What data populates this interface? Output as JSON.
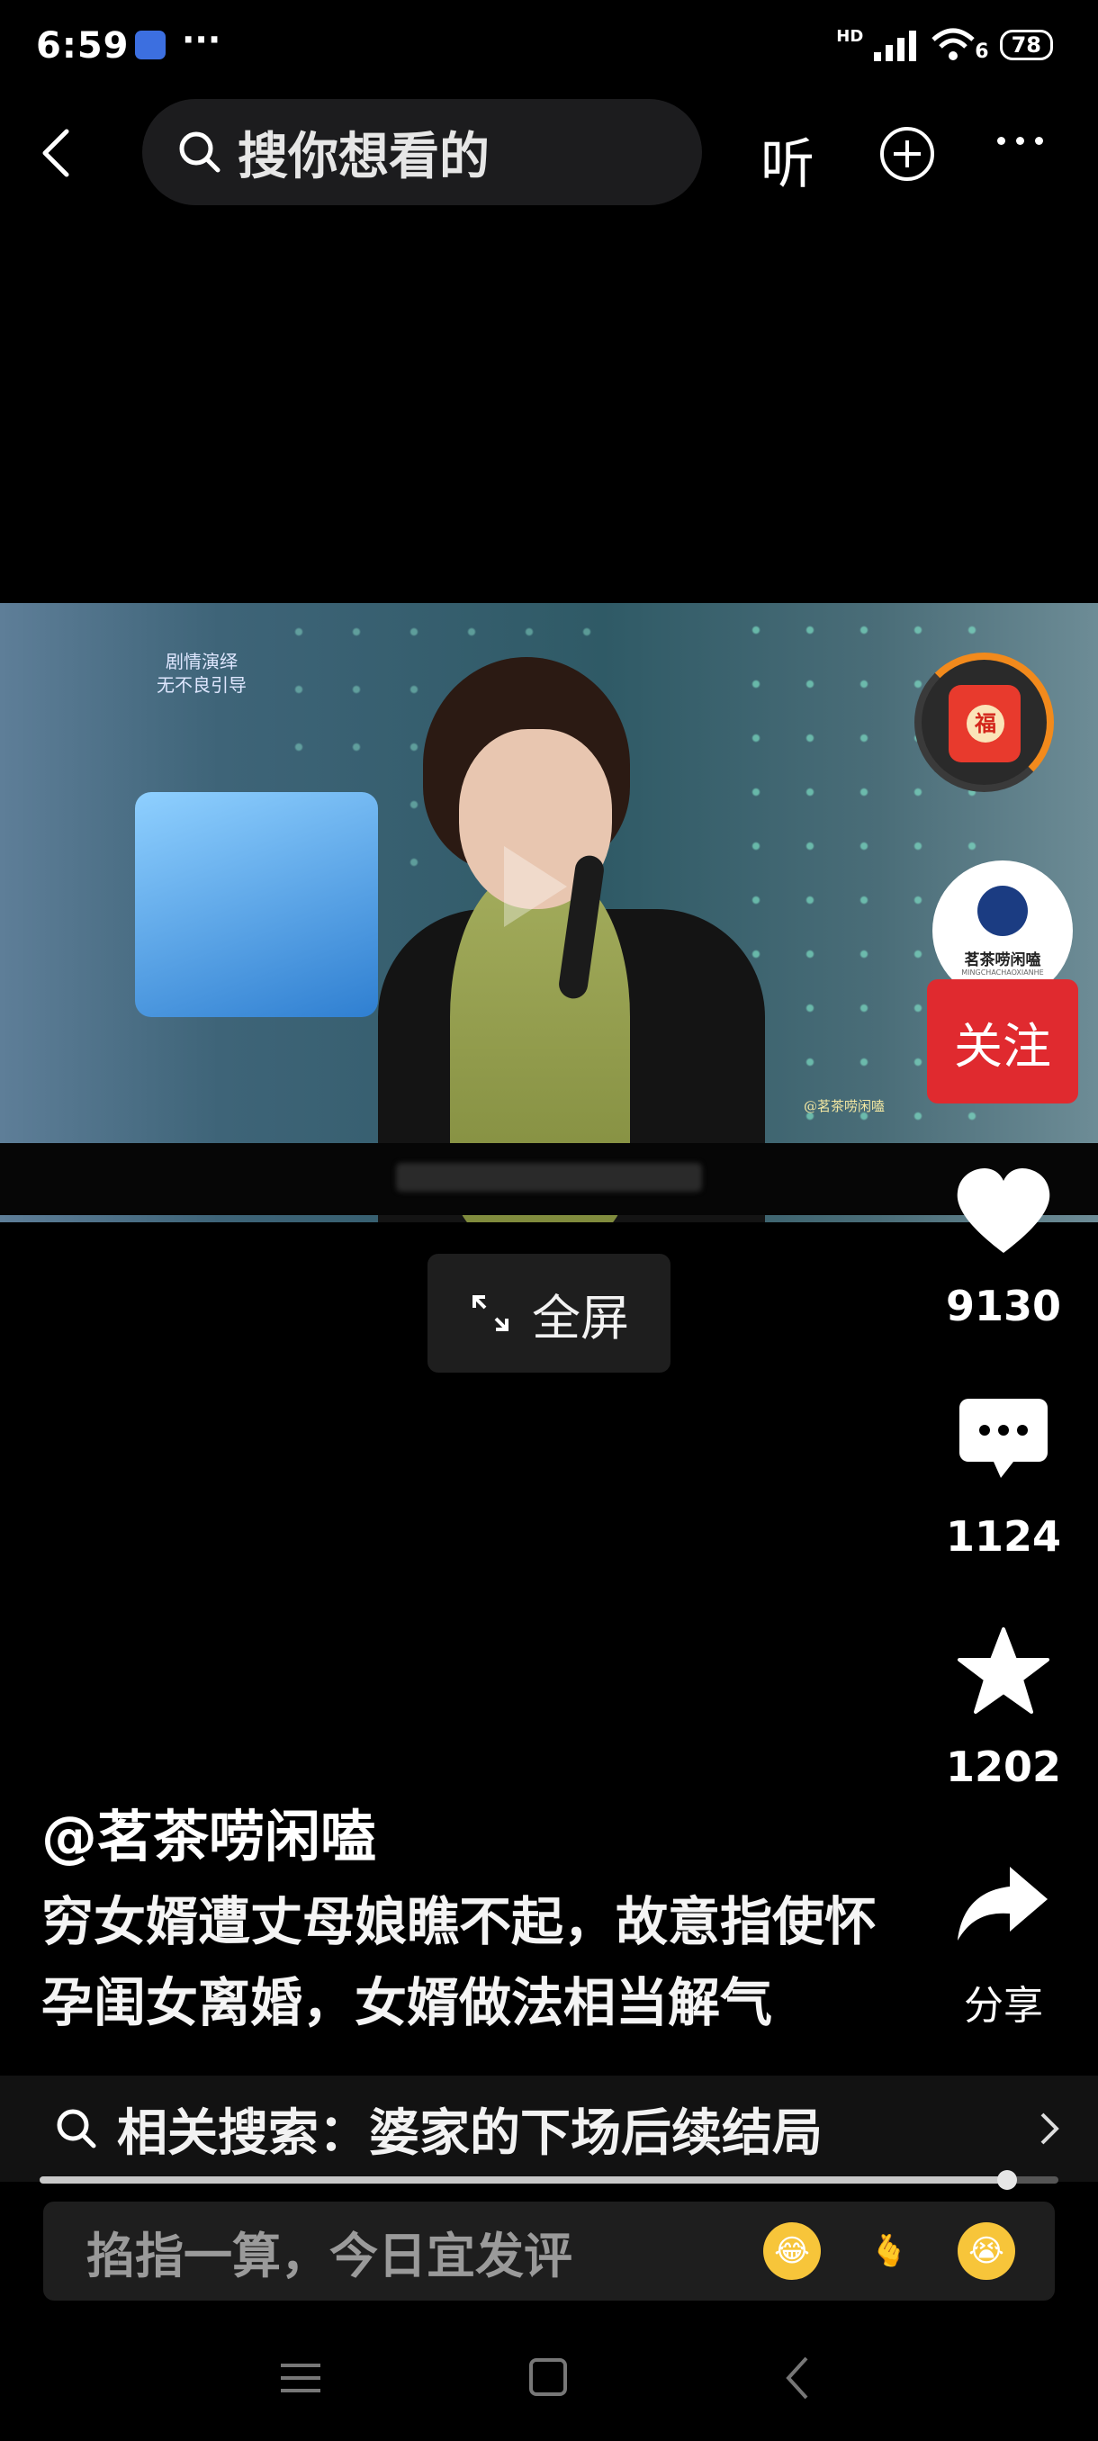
{
  "status_bar": {
    "time": "6:59",
    "more": "···",
    "network": "HD",
    "wifi_badge": "6",
    "battery": "78"
  },
  "top_bar": {
    "search_placeholder": "搜你想看的",
    "listen_label": "听"
  },
  "video": {
    "watermark_top": "剧情演绎\n无不良引导",
    "watermark_corner": "@茗茶唠闲嗑"
  },
  "fullscreen_label": "全屏",
  "right_rail": {
    "badge_char": "福",
    "avatar_name": "茗茶唠闲嗑",
    "avatar_sub": "MINGCHACHAOXIANHE",
    "follow_label": "关注",
    "likes": "9130",
    "comments": "1124",
    "favorites": "1202",
    "share_label": "分享"
  },
  "post": {
    "author": "@茗茶唠闲嗑",
    "caption": "穷女婿遭丈母娘瞧不起，故意指使怀孕闺女离婚，女婿做法相当解气"
  },
  "related_search": "相关搜索：婆家的下场后续结局",
  "progress": 0.95,
  "comment_placeholder": "掐指一算，今日宜发评",
  "colors": {
    "follow": "#e02a2f",
    "background": "#000000"
  }
}
